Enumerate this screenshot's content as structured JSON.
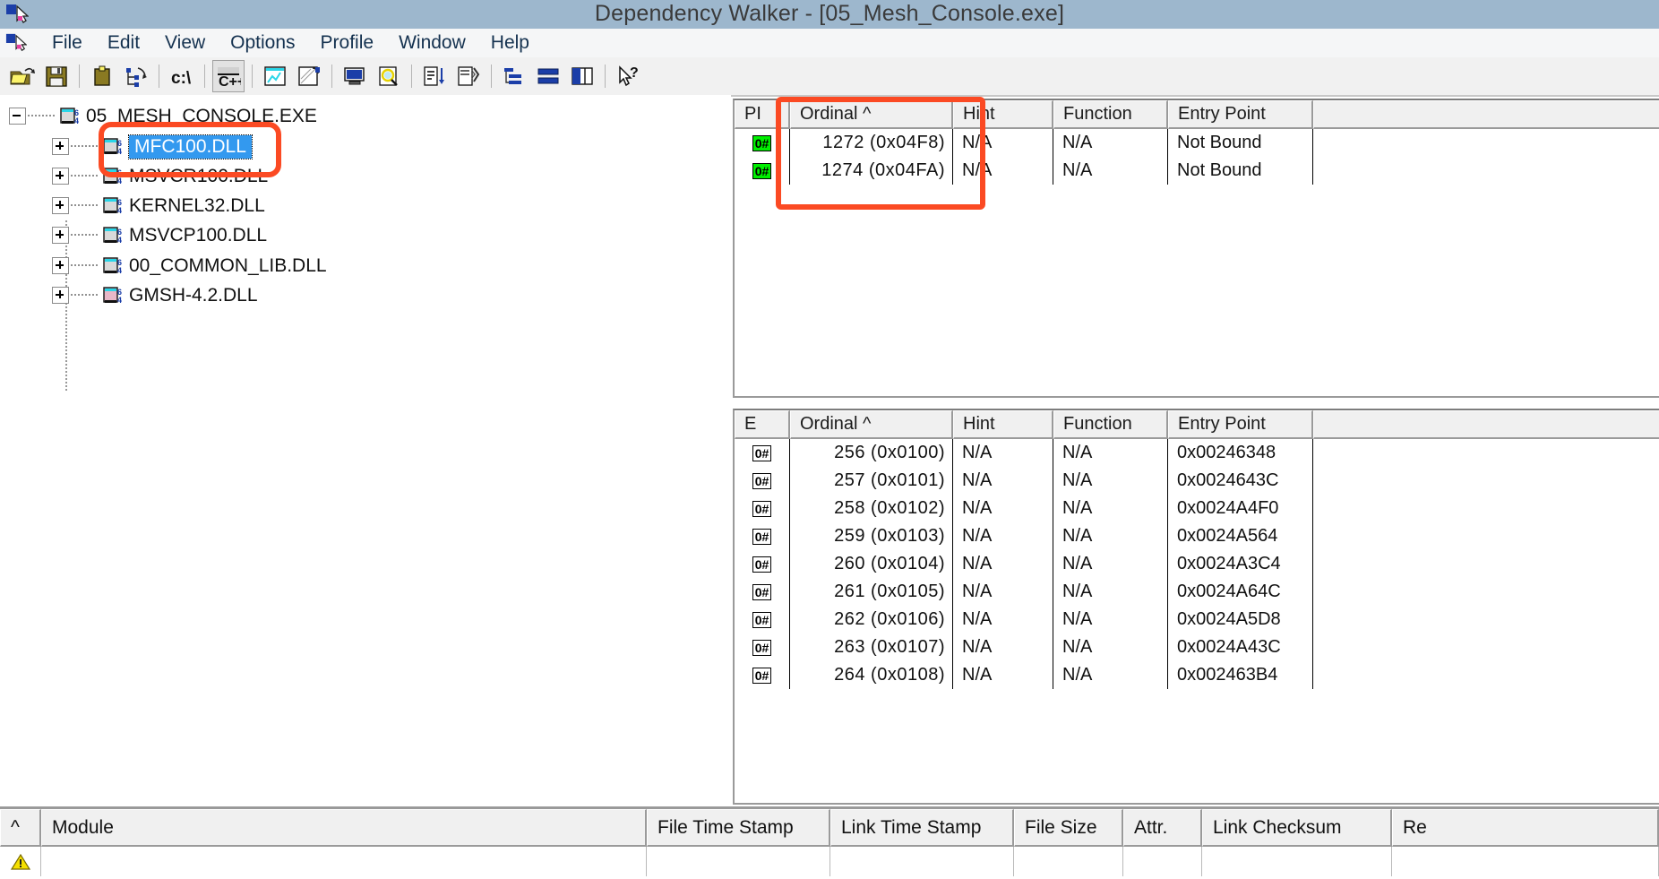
{
  "window": {
    "title": "Dependency Walker - [05_Mesh_Console.exe]",
    "icon": "dependency-walker-icon"
  },
  "menu": {
    "items": [
      {
        "label": "File"
      },
      {
        "label": "Edit"
      },
      {
        "label": "View"
      },
      {
        "label": "Options"
      },
      {
        "label": "Profile"
      },
      {
        "label": "Window"
      },
      {
        "label": "Help"
      }
    ]
  },
  "toolbar": {
    "buttons": [
      {
        "name": "open-file-icon",
        "glyph": "folder-open"
      },
      {
        "name": "save-icon",
        "glyph": "floppy-disk"
      },
      {
        "name": "copy-icon",
        "glyph": "clipboard"
      },
      {
        "name": "expand-tree-icon",
        "glyph": "tree-expand"
      },
      {
        "name": "full-paths-icon",
        "glyph": "c-drive"
      },
      {
        "name": "undecorate-cpp-icon",
        "glyph": "cpp",
        "pressed": true
      },
      {
        "name": "view-module-icon",
        "glyph": "module-chart"
      },
      {
        "name": "configure-module-icon",
        "glyph": "module-config"
      },
      {
        "name": "system-info-icon",
        "glyph": "computer"
      },
      {
        "name": "search-order-icon",
        "glyph": "magnifier"
      },
      {
        "name": "sort-list-icon",
        "glyph": "sort-down"
      },
      {
        "name": "profile-icon",
        "glyph": "profile-run"
      },
      {
        "name": "auto-expand-icon",
        "glyph": "layout-rows"
      },
      {
        "name": "horizontal-split-icon",
        "glyph": "split-horizontal"
      },
      {
        "name": "vertical-split-icon",
        "glyph": "split-vertical"
      },
      {
        "name": "context-help-icon",
        "glyph": "arrow-question"
      }
    ]
  },
  "tree": {
    "root": {
      "label": "05_MESH_CONSOLE.EXE",
      "expander": "minus",
      "icon": "module-64-icon"
    },
    "children": [
      {
        "label": "MFC100.DLL",
        "expander": "plus",
        "icon": "module-64-icon",
        "selected": true
      },
      {
        "label": "MSVCR100.DLL",
        "expander": "plus",
        "icon": "module-64-icon",
        "selected": false
      },
      {
        "label": "KERNEL32.DLL",
        "expander": "plus",
        "icon": "module-64-icon",
        "selected": false
      },
      {
        "label": "MSVCP100.DLL",
        "expander": "plus",
        "icon": "module-64-icon",
        "selected": false
      },
      {
        "label": "00_COMMON_LIB.DLL",
        "expander": "plus",
        "icon": "module-64-icon",
        "selected": false
      },
      {
        "label": "GMSH-4.2.DLL",
        "expander": "plus",
        "icon": "module-64-icon",
        "selected": false
      }
    ]
  },
  "import_table": {
    "headers": [
      "PI",
      "Ordinal ^",
      "Hint",
      "Function",
      "Entry Point",
      ""
    ],
    "rows": [
      {
        "flag": "0#",
        "ordinal": "1272 (0x04F8)",
        "hint": "N/A",
        "function": "N/A",
        "entry_point": "Not Bound"
      },
      {
        "flag": "0#",
        "ordinal": "1274 (0x04FA)",
        "hint": "N/A",
        "function": "N/A",
        "entry_point": "Not Bound"
      }
    ]
  },
  "export_table": {
    "headers": [
      "E",
      "Ordinal ^",
      "Hint",
      "Function",
      "Entry Point",
      ""
    ],
    "rows": [
      {
        "flag": "0#",
        "ordinal": "256 (0x0100)",
        "hint": "N/A",
        "function": "N/A",
        "entry_point": "0x00246348"
      },
      {
        "flag": "0#",
        "ordinal": "257 (0x0101)",
        "hint": "N/A",
        "function": "N/A",
        "entry_point": "0x0024643C"
      },
      {
        "flag": "0#",
        "ordinal": "258 (0x0102)",
        "hint": "N/A",
        "function": "N/A",
        "entry_point": "0x0024A4F0"
      },
      {
        "flag": "0#",
        "ordinal": "259 (0x0103)",
        "hint": "N/A",
        "function": "N/A",
        "entry_point": "0x0024A564"
      },
      {
        "flag": "0#",
        "ordinal": "260 (0x0104)",
        "hint": "N/A",
        "function": "N/A",
        "entry_point": "0x0024A3C4"
      },
      {
        "flag": "0#",
        "ordinal": "261 (0x0105)",
        "hint": "N/A",
        "function": "N/A",
        "entry_point": "0x0024A64C"
      },
      {
        "flag": "0#",
        "ordinal": "262 (0x0106)",
        "hint": "N/A",
        "function": "N/A",
        "entry_point": "0x0024A5D8"
      },
      {
        "flag": "0#",
        "ordinal": "263 (0x0107)",
        "hint": "N/A",
        "function": "N/A",
        "entry_point": "0x0024A43C"
      },
      {
        "flag": "0#",
        "ordinal": "264 (0x0108)",
        "hint": "N/A",
        "function": "N/A",
        "entry_point": "0x002463B4"
      }
    ]
  },
  "module_list": {
    "headers": [
      "^",
      "Module",
      "File Time Stamp",
      "Link Time Stamp",
      "File Size",
      "Attr.",
      "Link Checksum",
      "Re"
    ],
    "rows": [
      {
        "icon": "warning-icon",
        "module": "",
        "file_time_stamp": "",
        "link_time_stamp": "",
        "file_size": "",
        "attr": "",
        "link_checksum": "",
        "re": ""
      }
    ]
  },
  "annotations": [
    {
      "name": "tree-highlight-box",
      "target": "MFC100.DLL"
    },
    {
      "name": "import-ordinal-highlight-box",
      "target": "Ordinal column"
    }
  ],
  "colors": {
    "titlebar": "#9db7cd",
    "selection": "#3399ef",
    "annotation": "#fb4a23",
    "badge_green": "#00ef00",
    "toolbar_bg": "#f1f1f1"
  }
}
